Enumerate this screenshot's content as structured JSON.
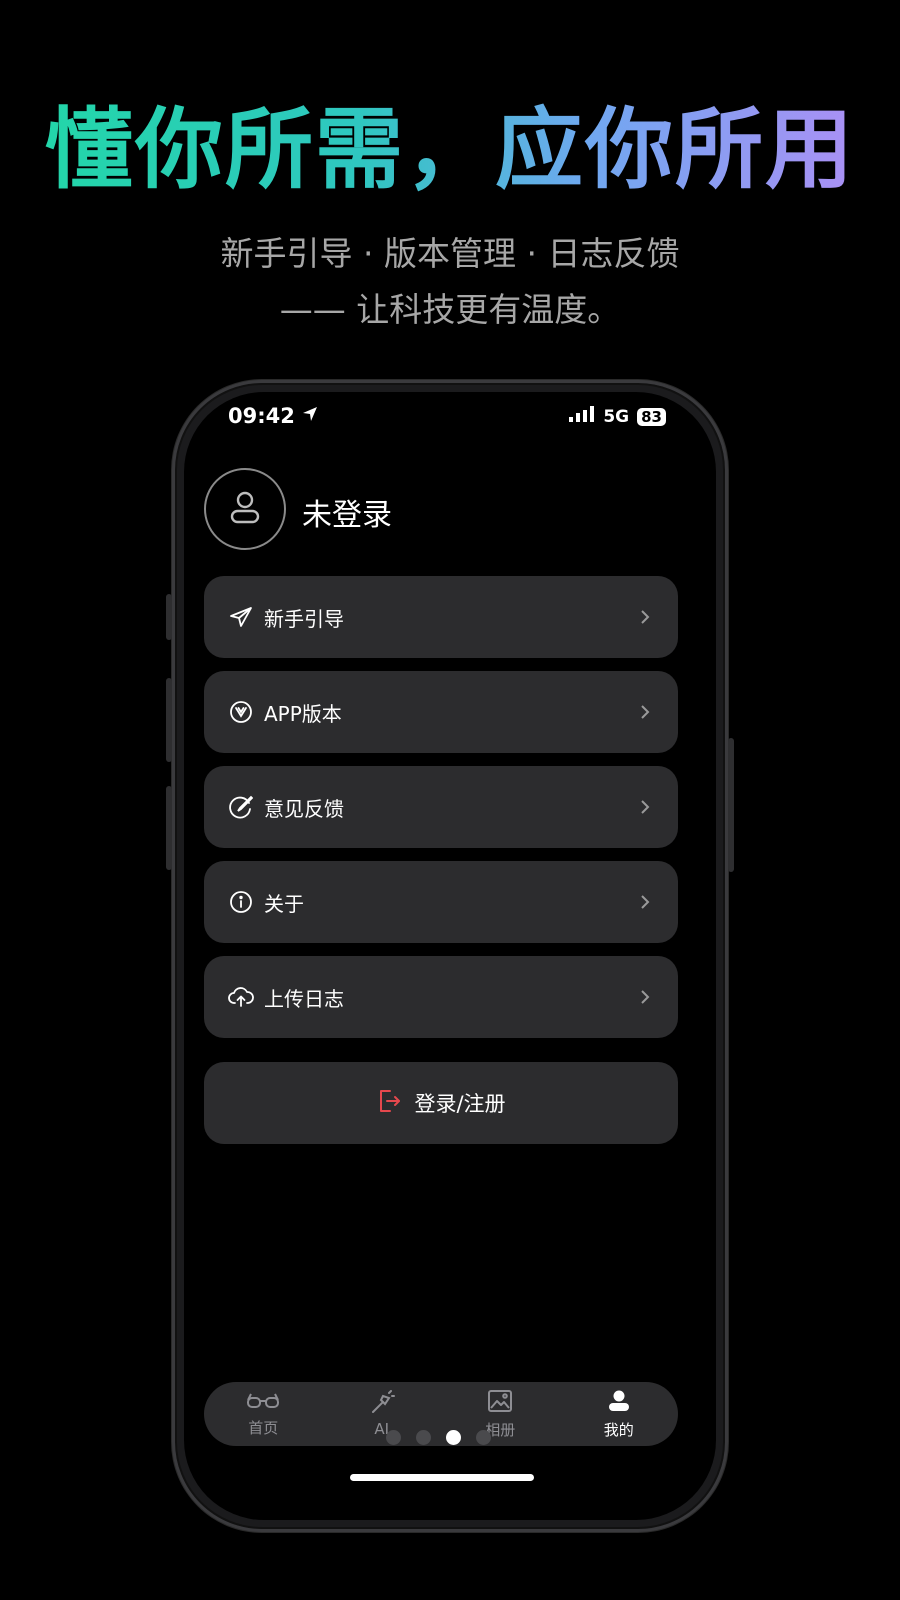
{
  "promo": {
    "headline": "懂你所需，应你所用",
    "subline1": "新手引导 · 版本管理 · 日志反馈",
    "subline2": "—— 让科技更有温度。"
  },
  "status_bar": {
    "time": "09:42",
    "network": "5G",
    "battery": "83"
  },
  "profile": {
    "login_status": "未登录"
  },
  "menu": {
    "items": [
      {
        "label": "新手引导",
        "icon": "paper-plane-icon"
      },
      {
        "label": "APP版本",
        "icon": "version-badge-icon"
      },
      {
        "label": "意见反馈",
        "icon": "feedback-pen-icon"
      },
      {
        "label": "关于",
        "icon": "info-icon"
      },
      {
        "label": "上传日志",
        "icon": "cloud-upload-icon"
      }
    ]
  },
  "login_button": {
    "label": "登录/注册",
    "icon": "logout-door-icon",
    "icon_color": "#e5484d"
  },
  "tabbar": {
    "tabs": [
      {
        "label": "首页",
        "icon": "glasses-icon"
      },
      {
        "label": "AI",
        "icon": "magic-wand-icon"
      },
      {
        "label": "相册",
        "icon": "photo-icon"
      },
      {
        "label": "我的",
        "icon": "user-icon"
      }
    ],
    "active": "我的"
  },
  "pager": {
    "count": 4,
    "active_index": 2
  }
}
